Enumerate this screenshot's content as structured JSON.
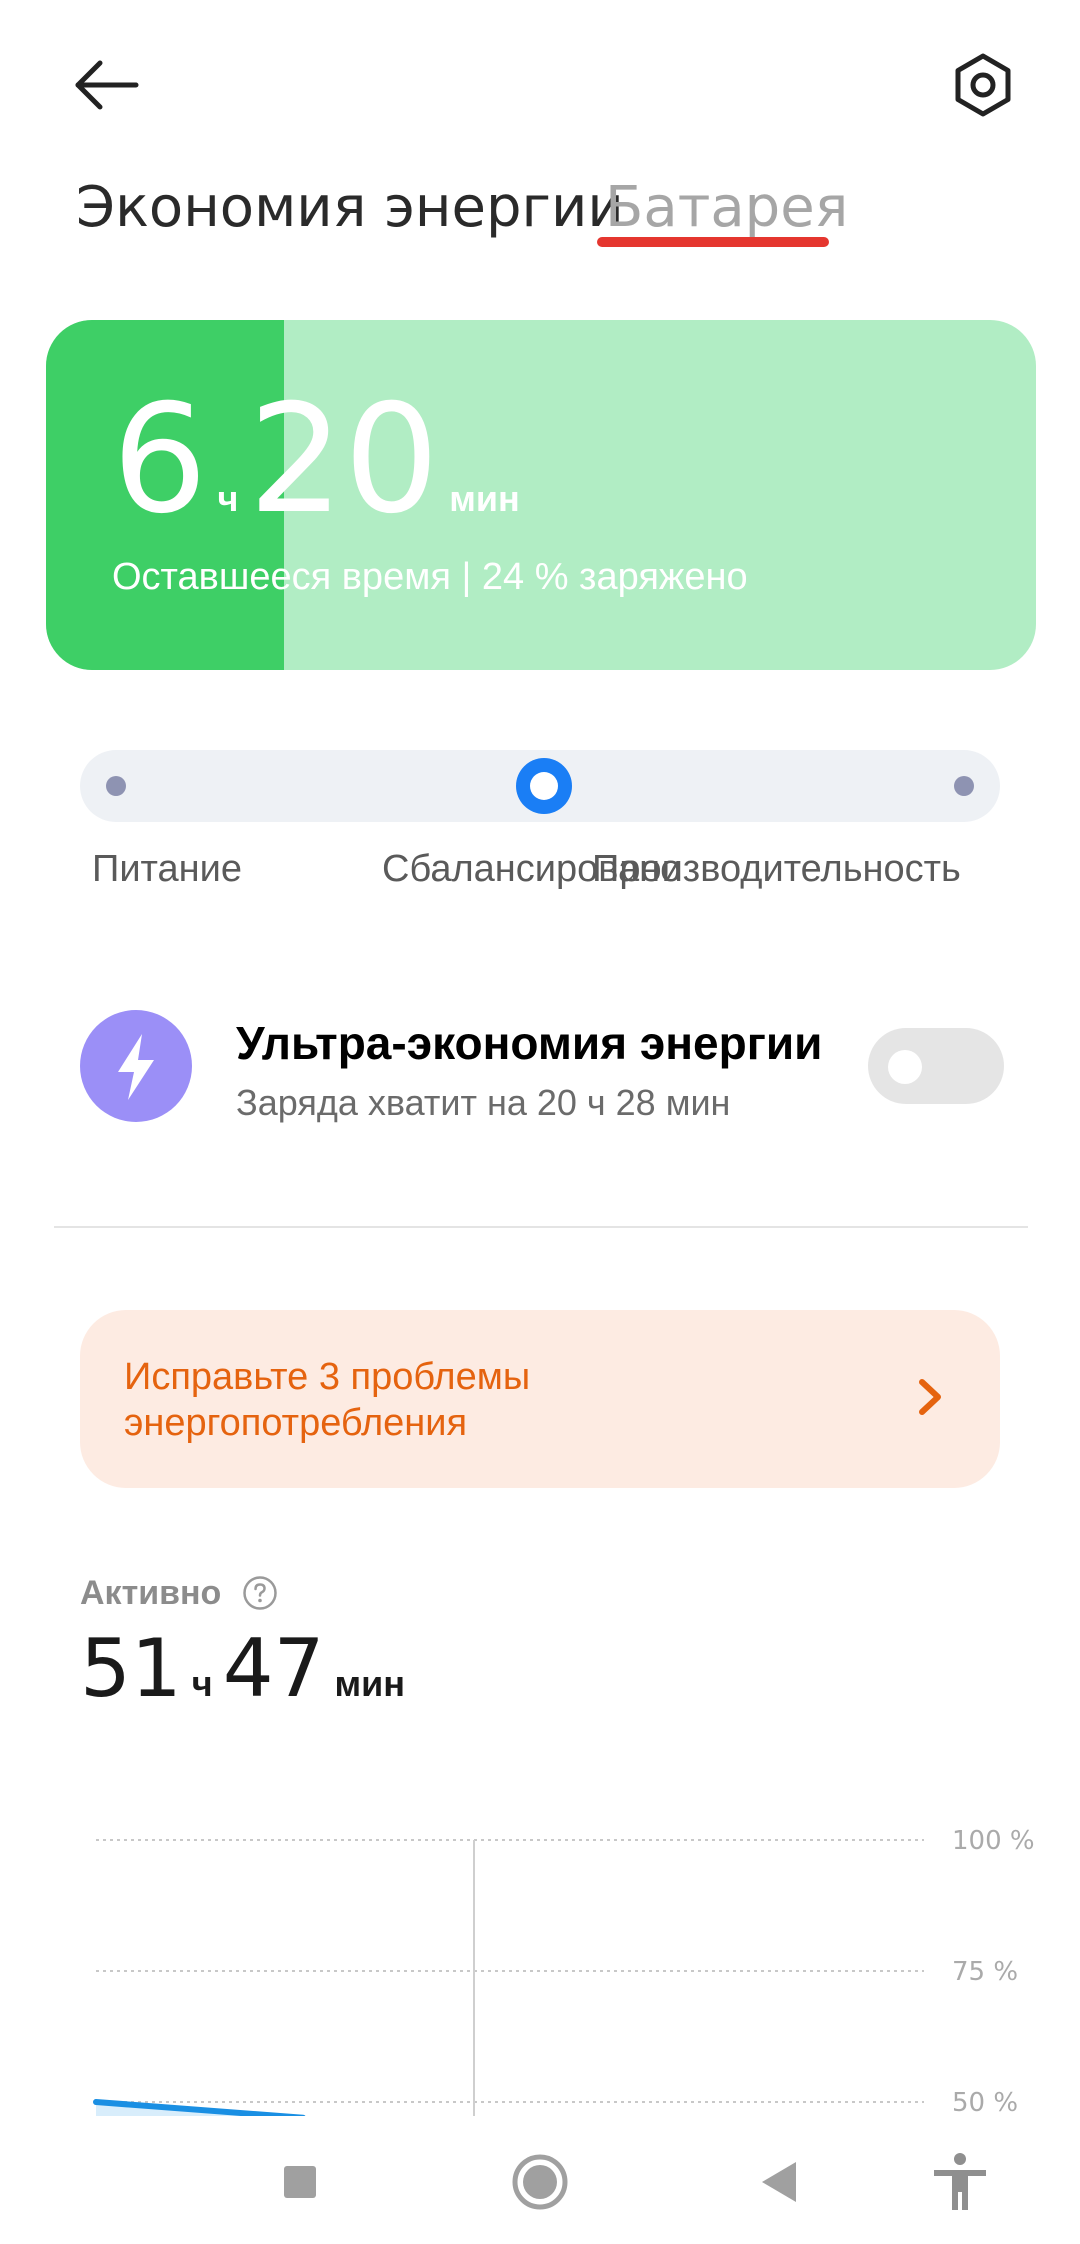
{
  "tabs": {
    "energy": "Экономия энергии",
    "battery": "Батарея"
  },
  "battery": {
    "hours": "6",
    "hours_unit": "ч",
    "minutes": "20",
    "minutes_unit": "мин",
    "subtitle": "Оставшееся время | 24 % заряжено",
    "charge_fraction": 0.24,
    "fill_color": "#3ecf66",
    "bg_color": "#b1edc4"
  },
  "modes": {
    "labels": [
      "Питание",
      "Сбалансировано",
      "Производительность"
    ],
    "selected_index": 1,
    "accent_color": "#1a7ef5"
  },
  "ultra": {
    "title": "Ультра-экономия энергии",
    "subtitle": "Заряда хватит на 20 ч 28 мин",
    "enabled": false,
    "icon": "lightning-icon",
    "icon_color": "#9b8ff7"
  },
  "fix": {
    "line1": "Исправьте 3 проблемы",
    "line2": "энергопотребления",
    "color": "#e5630f",
    "bg_color": "#fdebe2"
  },
  "active": {
    "label": "Активно",
    "hours": "51",
    "hours_unit": "ч",
    "minutes": "47",
    "minutes_unit": "мин"
  },
  "chart_data": {
    "type": "area",
    "y_ticks": [
      "100 %",
      "75 %",
      "50 %"
    ],
    "ylim": [
      0,
      100
    ],
    "x": [
      0,
      0.25
    ],
    "values": [
      50,
      47
    ],
    "line_color": "#1a8fe3",
    "grid": true
  },
  "nav": {
    "icons": [
      "recents-icon",
      "home-icon",
      "back-icon",
      "accessibility-icon"
    ]
  }
}
